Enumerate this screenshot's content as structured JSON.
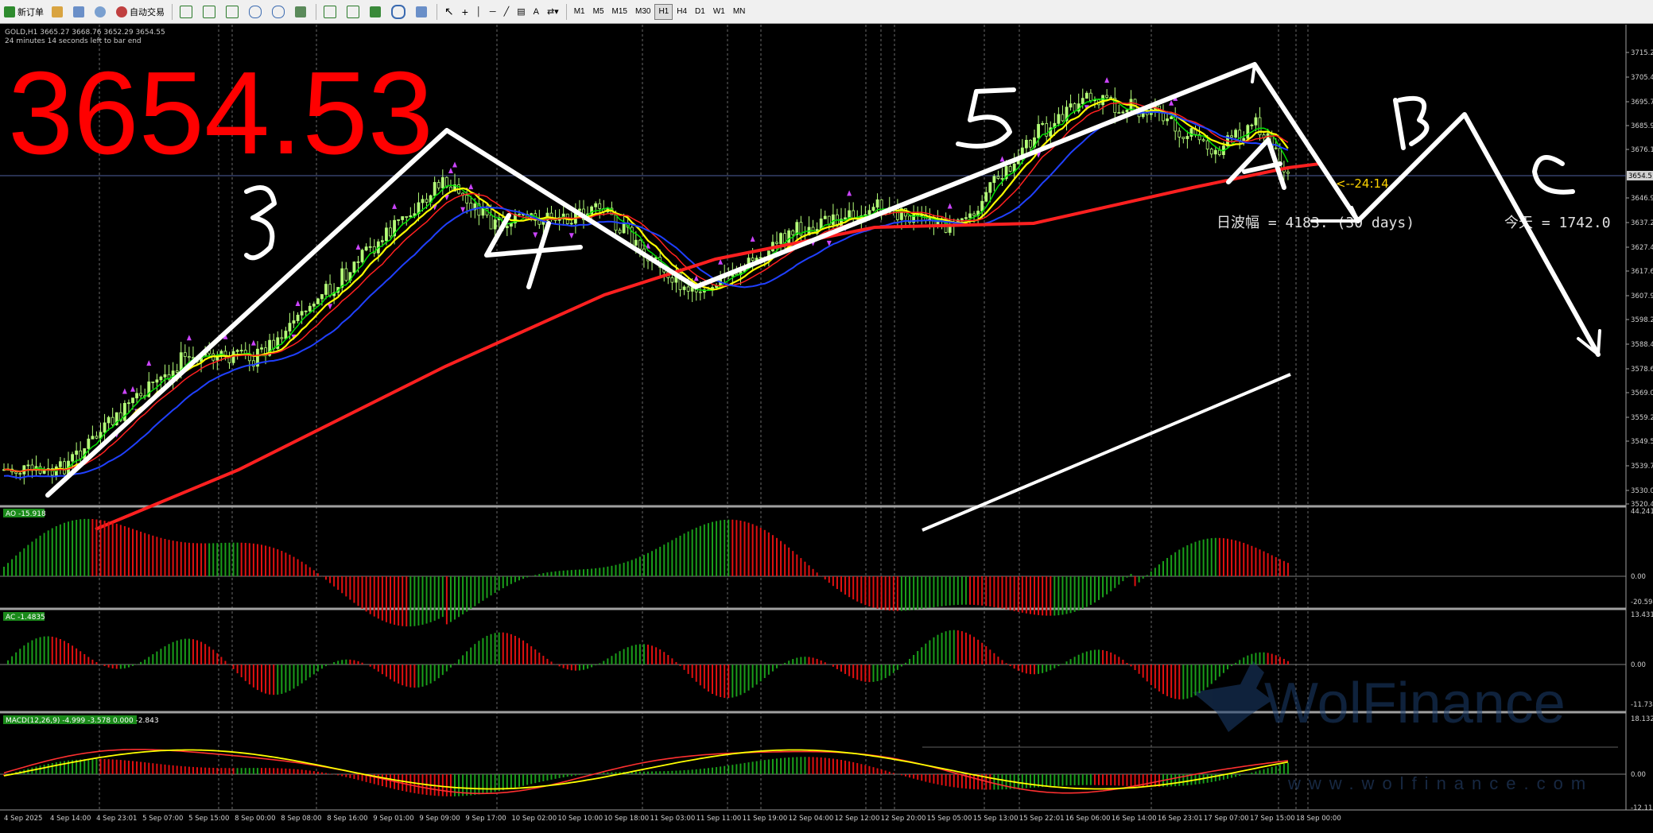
{
  "toolbar": {
    "new_order": "新订单",
    "auto_trading": "自动交易",
    "text_tool": "A",
    "timeframes": [
      "M1",
      "M5",
      "M15",
      "M30",
      "H1",
      "H4",
      "D1",
      "W1",
      "MN"
    ],
    "active_timeframe": "H1"
  },
  "main_panel": {
    "symbol_info": "GOLD,H1  3665.27 3668.76 3652.29 3654.55",
    "bar_timer": "24 minutes 14 seconds left to bar end",
    "big_price": "3654.53",
    "current_price_label": "3654.5",
    "countdown_label": "<--24:14",
    "volatility_label": "日波幅 = 4183.    (30 days)",
    "today_label": "今天 = 1742.0",
    "price_ticks": [
      "3715.2",
      "3705.4",
      "3695.7",
      "3685.9",
      "3676.1",
      "3666.4",
      "3646.9",
      "3637.2",
      "3627.4",
      "3617.6",
      "3607.9",
      "3598.2",
      "3588.4",
      "3578.6",
      "3569.0",
      "3559.2",
      "3549.5",
      "3539.7",
      "3530.0",
      "3520.4"
    ],
    "wave_labels": [
      "3",
      "4",
      "5",
      "A",
      "B",
      "C"
    ]
  },
  "ao_panel": {
    "label": "AO -15.918",
    "ticks": [
      "44.241",
      "0.00",
      "-20.594"
    ]
  },
  "ac_panel": {
    "label": "AC -1.4835",
    "ticks": [
      "13.4315",
      "0.00",
      "-11.734"
    ]
  },
  "macd_panel": {
    "label": "MACD(12,26,9) -4.999 -3.578 0.000 -2.843",
    "ticks": [
      "18.132",
      "0.00",
      "-12.11"
    ]
  },
  "watermark": {
    "brand": "WolFinance",
    "url": "www.wolfinance.com"
  },
  "time_axis": [
    "4 Sep 2025",
    "4 Sep 14:00",
    "4 Sep 23:01",
    "5 Sep 07:00",
    "5 Sep 15:00",
    "8 Sep 00:00",
    "8 Sep 08:00",
    "8 Sep 16:00",
    "9 Sep 01:00",
    "9 Sep 09:00",
    "9 Sep 17:00",
    "10 Sep 02:00",
    "10 Sep 10:00",
    "10 Sep 18:00",
    "11 Sep 03:00",
    "11 Sep 11:00",
    "11 Sep 19:00",
    "12 Sep 04:00",
    "12 Sep 12:00",
    "12 Sep 20:00",
    "15 Sep 05:00",
    "15 Sep 13:00",
    "15 Sep 22:01",
    "16 Sep 06:00",
    "16 Sep 14:00",
    "16 Sep 23:01",
    "17 Sep 07:00",
    "17 Sep 15:00",
    "18 Sep 00:00"
  ],
  "colors": {
    "background": "#000000",
    "bull_candle": "#b4ff78",
    "sma_fast": "#00e000",
    "sma_yellow": "#ffff00",
    "sma_red_thin": "#ff2020",
    "sma_blue": "#2040ff",
    "sma_red_thick": "#ff2020",
    "fractal": "#cc44ff",
    "histo_up": "#1a9e1a",
    "histo_down": "#e01010",
    "big_price": "#ff0000",
    "macd_main": "#ff3030",
    "macd_signal": "#ffff00"
  }
}
